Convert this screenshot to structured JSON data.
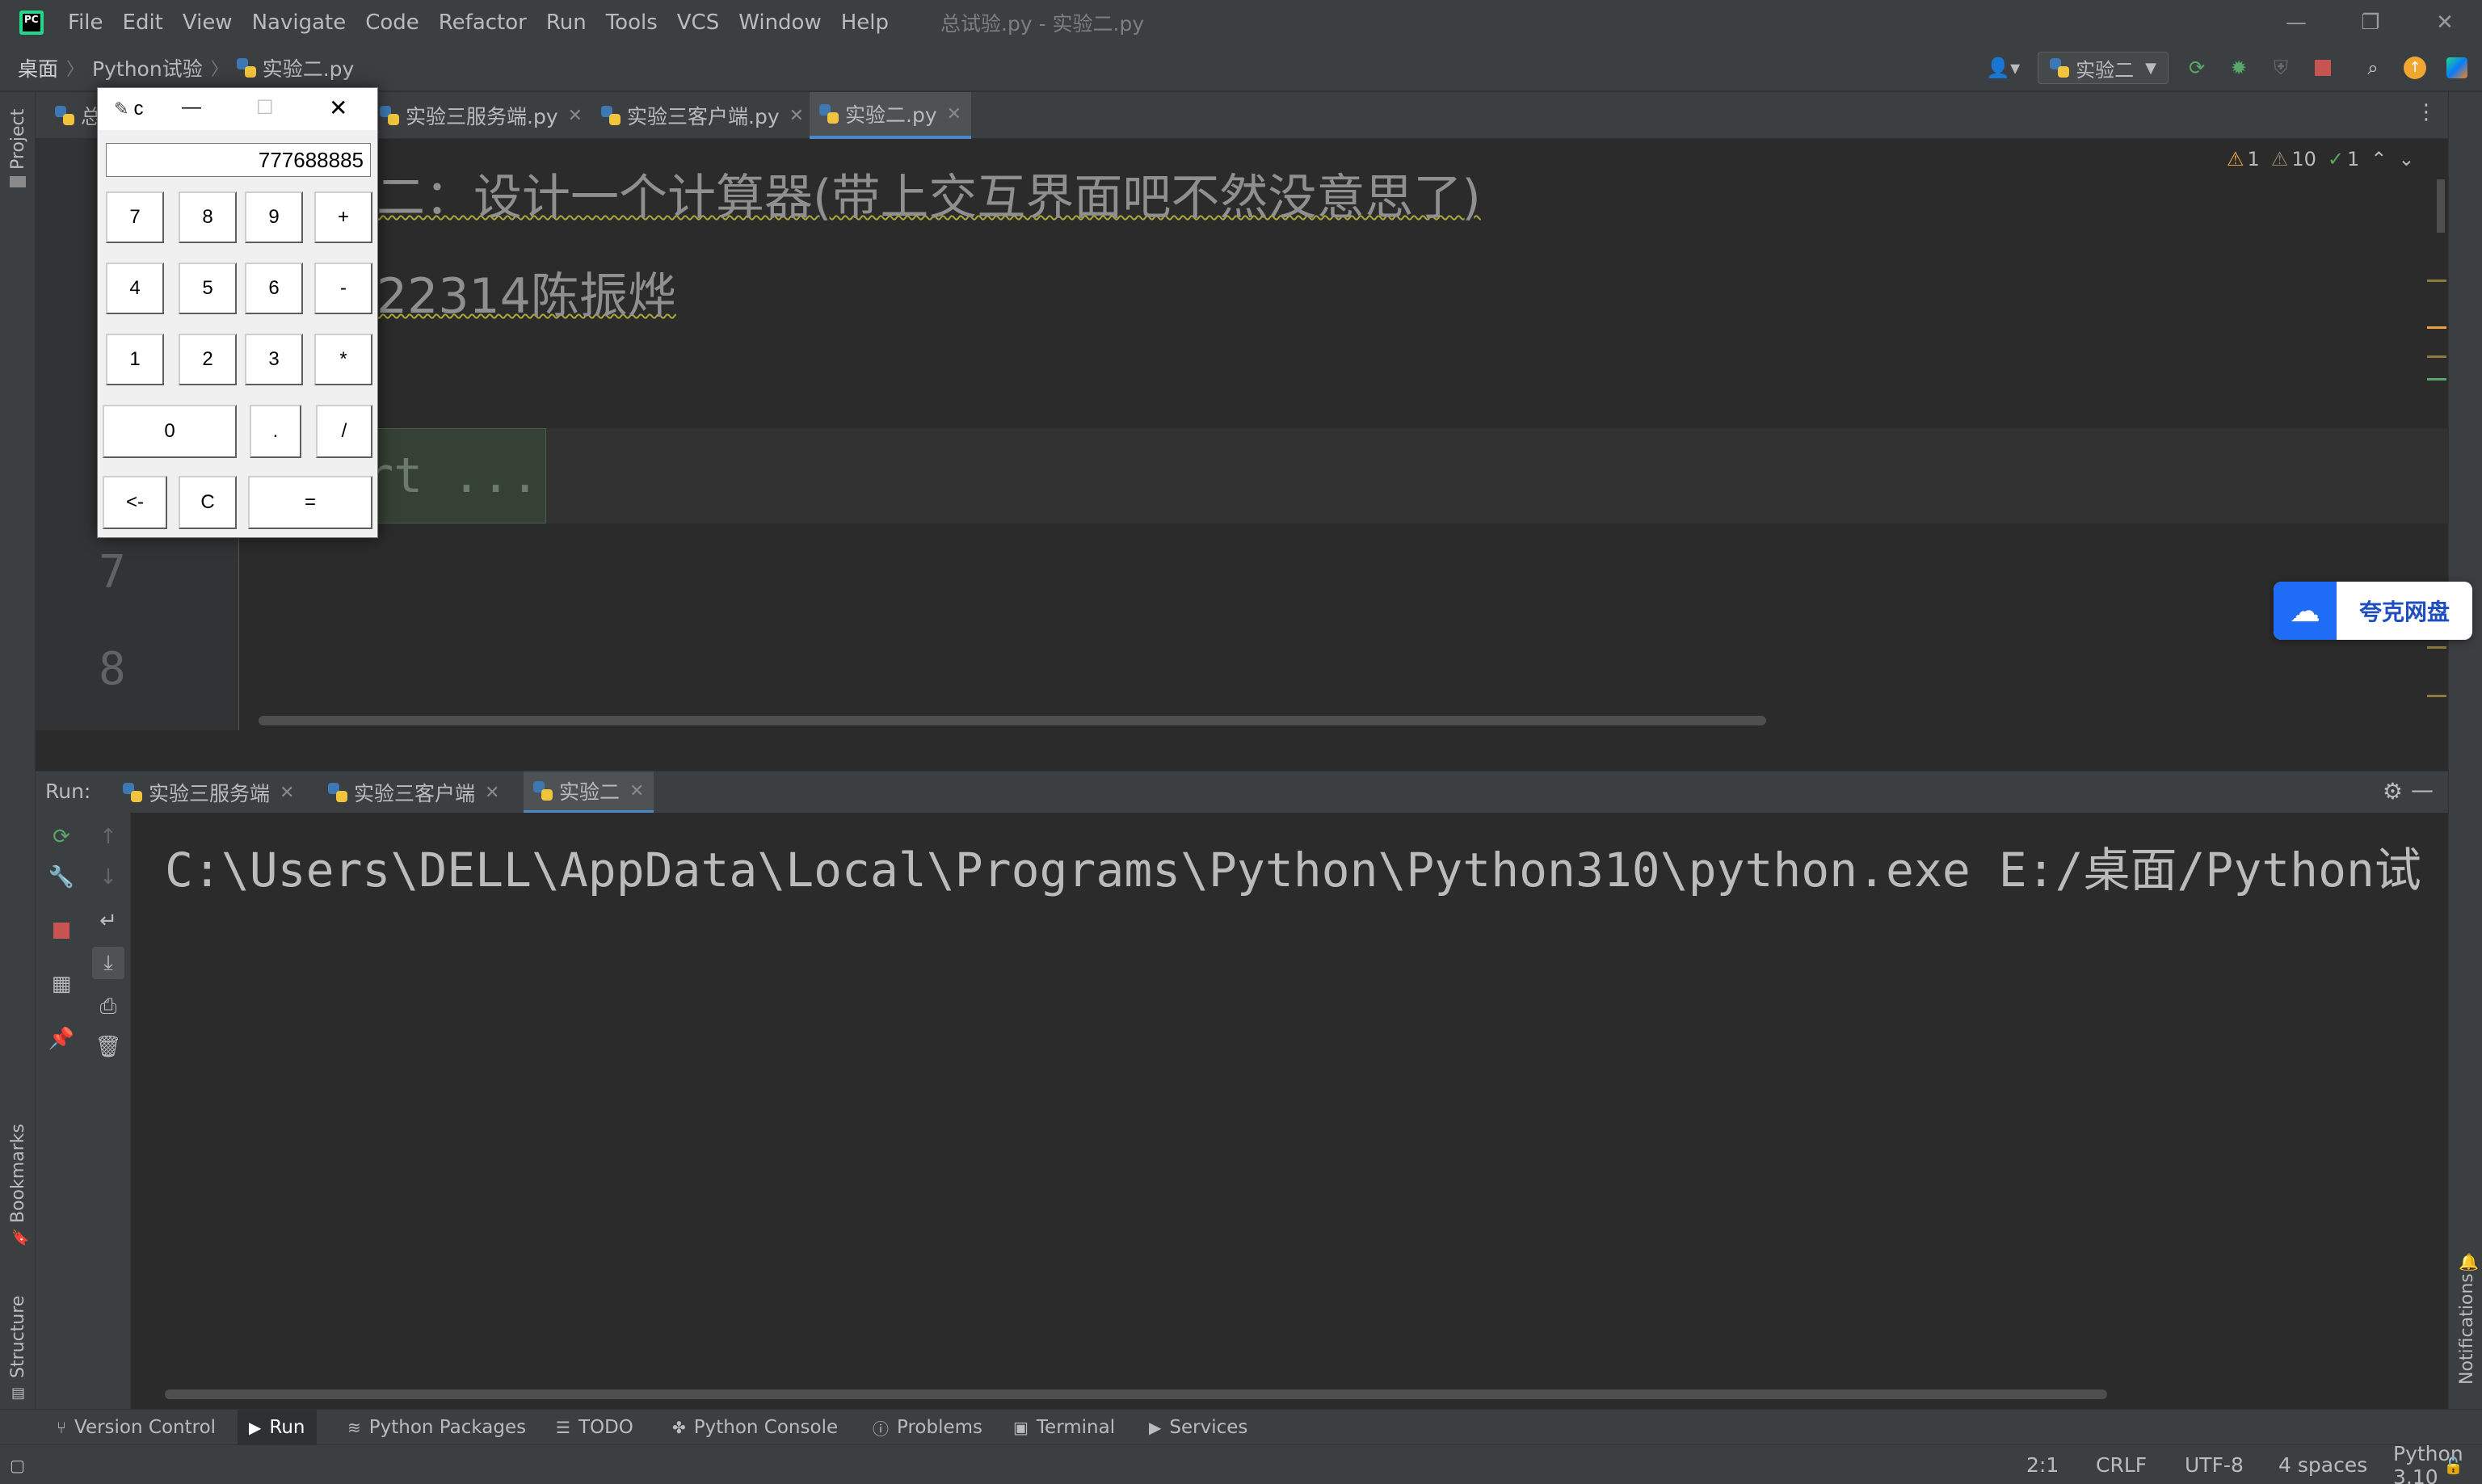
{
  "window": {
    "title": "总试验.py - 实验二.py"
  },
  "menu": [
    "File",
    "Edit",
    "View",
    "Navigate",
    "Code",
    "Refactor",
    "Run",
    "Tools",
    "VCS",
    "Window",
    "Help"
  ],
  "navbar": {
    "breadcrumb": [
      "桌面",
      "Python试验",
      "实验二.py"
    ],
    "run_config": "实验二"
  },
  "left_strip": {
    "project": "Project",
    "bookmarks": "Bookmarks",
    "structure": "Structure"
  },
  "right_strip": {
    "notifications": "Notifications"
  },
  "tabs": [
    {
      "label": "总"
    },
    {
      "label": "实验三服务端.py"
    },
    {
      "label": "实验三客户端.py"
    },
    {
      "label": "实验二.py",
      "active": true
    }
  ],
  "inspections": {
    "warnings": "1",
    "weak_warnings": "10",
    "ok": "1"
  },
  "editor": {
    "lines": [
      {
        "text": "二：设计一个计算器(带上交互界面吧不然没意思了)"
      },
      {
        "text": "22314陈振烨"
      },
      {
        "text": "rt ..."
      }
    ],
    "line_numbers": [
      "7",
      "8"
    ]
  },
  "run_panel": {
    "label": "Run:",
    "tabs": [
      "实验三服务端",
      "实验三客户端",
      "实验二"
    ],
    "console": "C:\\Users\\DELL\\AppData\\Local\\Programs\\Python\\Python310\\python.exe E:/桌面/Python试"
  },
  "bottom_tools": [
    "Version Control",
    "Run",
    "Python Packages",
    "TODO",
    "Python Console",
    "Problems",
    "Terminal",
    "Services"
  ],
  "status": {
    "position": "2:1",
    "line_sep": "CRLF",
    "encoding": "UTF-8",
    "indent": "4 spaces",
    "interpreter": "Python 3.10"
  },
  "calculator": {
    "title": "c",
    "display": "777688885",
    "keys": [
      "7",
      "8",
      "9",
      "+",
      "4",
      "5",
      "6",
      "-",
      "1",
      "2",
      "3",
      "*",
      "0",
      ".",
      "/",
      "<-",
      "C",
      "="
    ]
  },
  "quark": {
    "label": "夸克网盘"
  },
  "colors": {
    "accent": "#4a88c7",
    "python_blue": "#3d78b3",
    "python_yellow": "#f2c43d",
    "quark_blue": "#1f6cf7"
  }
}
